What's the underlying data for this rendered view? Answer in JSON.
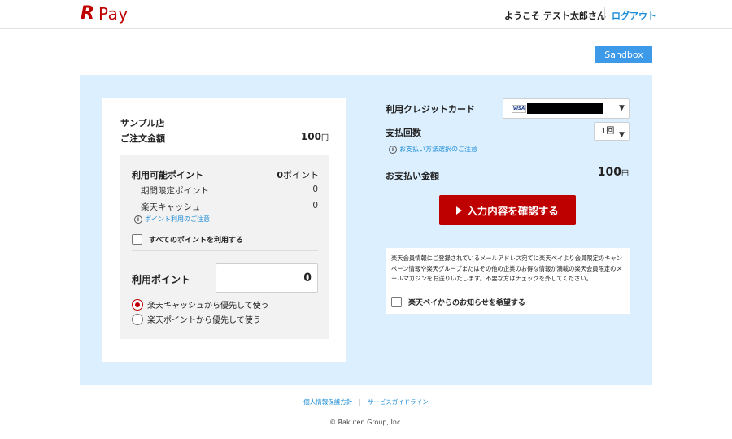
{
  "header": {
    "logo_r": "R",
    "logo_text": "Pay",
    "welcome": "ようこそ テスト太郎さん",
    "logout": "ログアウト"
  },
  "sandbox_label": "Sandbox",
  "order": {
    "shop_name": "サンプル店",
    "amount_label": "ご注文金額",
    "amount_value": "100",
    "yen": "円"
  },
  "points": {
    "available_label": "利用可能ポイント",
    "available_value": "0",
    "available_unit": "ポイント",
    "limited_label": "期間限定ポイント",
    "limited_value": "0",
    "cash_label": "楽天キャッシュ",
    "cash_value": "0",
    "note": "ポイント利用のご注意",
    "use_all_label": "すべてのポイントを利用する",
    "use_label": "利用ポイント",
    "use_value": "0",
    "option_cash_first": "楽天キャッシュから優先して使う",
    "option_points_first": "楽天ポイントから優先して使う",
    "selected_option": "option_cash_first"
  },
  "payment": {
    "card_label": "利用クレジットカード",
    "card_brand": "VISA",
    "count_label": "支払回数",
    "count_value": "1回",
    "method_note": "お支払い方法選択のご注意",
    "total_label": "お支払い金額",
    "total_value": "100",
    "yen": "円",
    "confirm_label": "入力内容を確認する"
  },
  "newsletter": {
    "text": "楽天会員情報にご登録されているメールアドレス宛てに楽天ペイより会員限定のキャンペーン情報や楽天グループまたはその他の企業のお得な情報が満載の楽天会員限定のメールマガジンをお送りいたします。不要な方はチェックを外してください。",
    "checkbox_label": "楽天ペイからのお知らせを希望する"
  },
  "footer": {
    "privacy": "個人情報保護方針",
    "guideline": "サービスガイドライン",
    "copyright": "© Rakuten Group, Inc."
  },
  "colors": {
    "brand_red": "#bf0000",
    "link_blue": "#1a8bd6",
    "panel_bg": "#dcefff",
    "sandbox_bg": "#3d9ae8"
  }
}
